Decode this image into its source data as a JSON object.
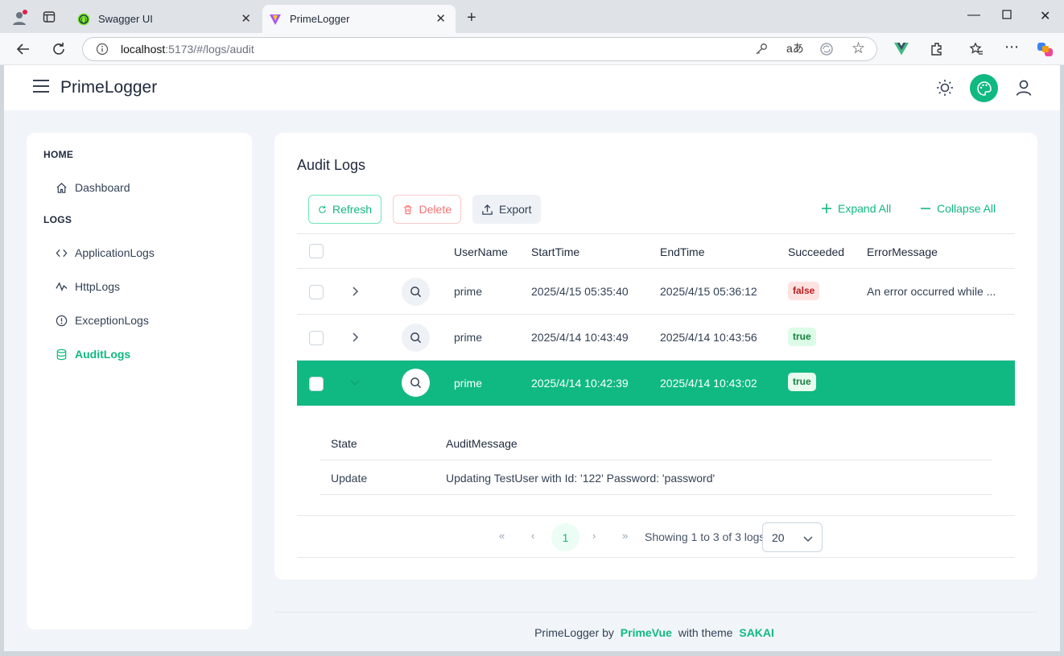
{
  "browser": {
    "tabs": [
      {
        "title": "Swagger UI"
      },
      {
        "title": "PrimeLogger"
      }
    ],
    "url_host": "localhost",
    "url_path": ":5173/#/logs/audit"
  },
  "app": {
    "brand": "PrimeLogger",
    "accent_color": "#10b981"
  },
  "sidebar": {
    "sections": [
      {
        "title": "HOME",
        "items": [
          {
            "label": "Dashboard",
            "icon": "home-icon"
          }
        ]
      },
      {
        "title": "LOGS",
        "items": [
          {
            "label": "ApplicationLogs",
            "icon": "code-icon"
          },
          {
            "label": "HttpLogs",
            "icon": "activity-icon"
          },
          {
            "label": "ExceptionLogs",
            "icon": "exclamation-circle-icon"
          },
          {
            "label": "AuditLogs",
            "icon": "database-icon",
            "active": true
          }
        ]
      }
    ]
  },
  "page": {
    "title": "Audit Logs",
    "toolbar": {
      "refresh": "Refresh",
      "delete": "Delete",
      "export": "Export",
      "expand_all": "Expand All",
      "collapse_all": "Collapse All"
    }
  },
  "table": {
    "columns": [
      "UserName",
      "StartTime",
      "EndTime",
      "Succeeded",
      "ErrorMessage"
    ],
    "rows": [
      {
        "user": "prime",
        "start": "2025/4/15 05:35:40",
        "end": "2025/4/15 05:36:12",
        "succeeded": "false",
        "error": "An error occurred while ..."
      },
      {
        "user": "prime",
        "start": "2025/4/14 10:43:49",
        "end": "2025/4/14 10:43:56",
        "succeeded": "true",
        "error": ""
      },
      {
        "user": "prime",
        "start": "2025/4/14 10:42:39",
        "end": "2025/4/14 10:43:02",
        "succeeded": "true",
        "error": "",
        "selected": true,
        "expanded": true
      }
    ],
    "detail": {
      "columns": [
        "State",
        "AuditMessage"
      ],
      "rows": [
        {
          "state": "Update",
          "message": "Updating TestUser with Id: '122' Password: 'password'"
        }
      ]
    }
  },
  "pagination": {
    "current_page": "1",
    "info": "Showing 1 to 3 of 3 logs",
    "page_size": "20"
  },
  "footer": {
    "prefix": "PrimeLogger by",
    "link1": "PrimeVue",
    "middle": "with theme",
    "link2": "SAKAI"
  }
}
